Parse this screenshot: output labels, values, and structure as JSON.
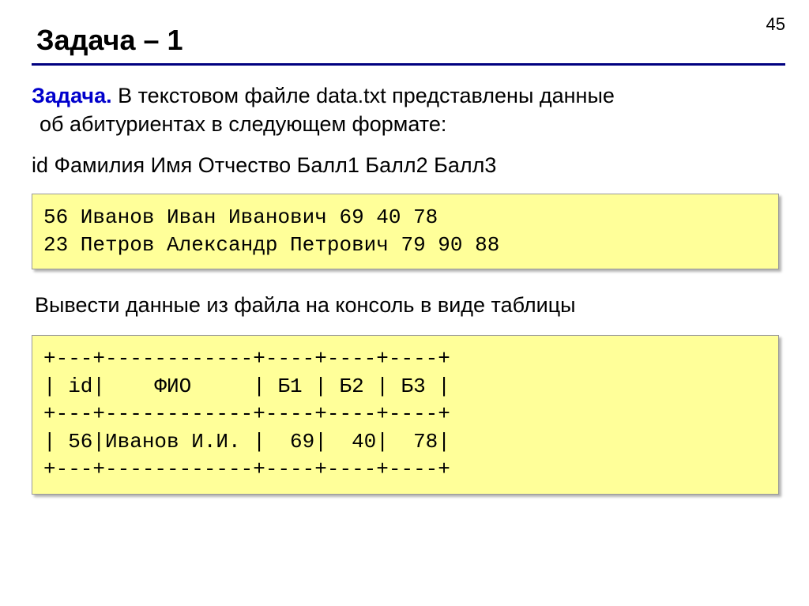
{
  "page_number": "45",
  "title": "Задача – 1",
  "task": {
    "label": "Задача.",
    "desc_part1": " В текстовом файле data.txt представлены данные",
    "desc_part2": "об абитуриентах в следующем формате:"
  },
  "format_line": "id Фамилия Имя Отчество Балл1 Балл2 Балл3",
  "code_block_1": "56 Иванов Иван Иванович 69 40 78\n23 Петров Александр Петрович 79 90 88",
  "output_text": "Вывести данные из файла на консоль в виде таблицы",
  "code_block_2": "+---+------------+----+----+----+\n| id|    ФИО     | Б1 | Б2 | Б3 |\n+---+------------+----+----+----+\n| 56|Иванов И.И. |  69|  40|  78|\n+---+------------+----+----+----+"
}
